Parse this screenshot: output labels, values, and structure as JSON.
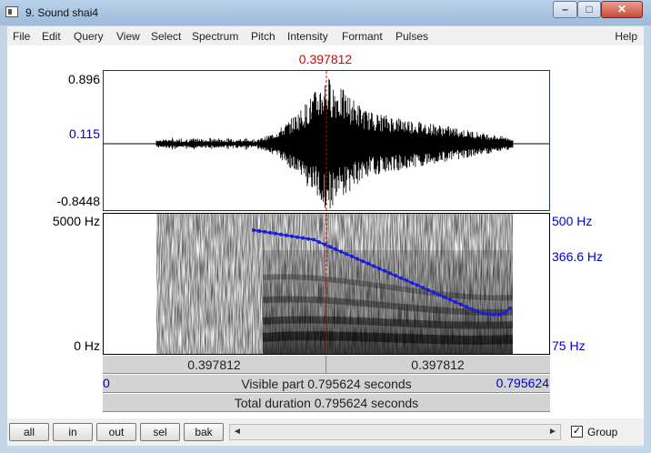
{
  "window": {
    "title": "9. Sound shai4",
    "minimize": "–",
    "maximize": "□",
    "close": "✕"
  },
  "menu": [
    "File",
    "Edit",
    "Query",
    "View",
    "Select",
    "Spectrum",
    "Pitch",
    "Intensity",
    "Formant",
    "Pulses"
  ],
  "help": "Help",
  "cursor": {
    "time": "0.397812"
  },
  "waveform": {
    "max": "0.896",
    "cursor_value": "0.115",
    "min": "-0.8448"
  },
  "spectrogram": {
    "freq_top": "5000 Hz",
    "freq_bottom": "0 Hz"
  },
  "pitch": {
    "top": "500 Hz",
    "value": "366.6 Hz",
    "bottom": "75 Hz"
  },
  "time_bar": {
    "left": "0.397812",
    "right": "0.397812"
  },
  "visible_bar": {
    "start": "0",
    "text": "Visible part 0.795624 seconds",
    "end": "0.795624"
  },
  "total_bar": {
    "text": "Total duration 0.795624 seconds"
  },
  "buttons": {
    "all": "all",
    "in": "in",
    "out": "out",
    "sel": "sel",
    "bak": "bak"
  },
  "scroll": {
    "left_arrow": "◄",
    "right_arrow": "►"
  },
  "group": {
    "label": "Group",
    "checked": "✓"
  },
  "colors": {
    "cursor": "#dd0000",
    "pitch": "#1c1cdd",
    "label_blue": "#0000cc"
  }
}
